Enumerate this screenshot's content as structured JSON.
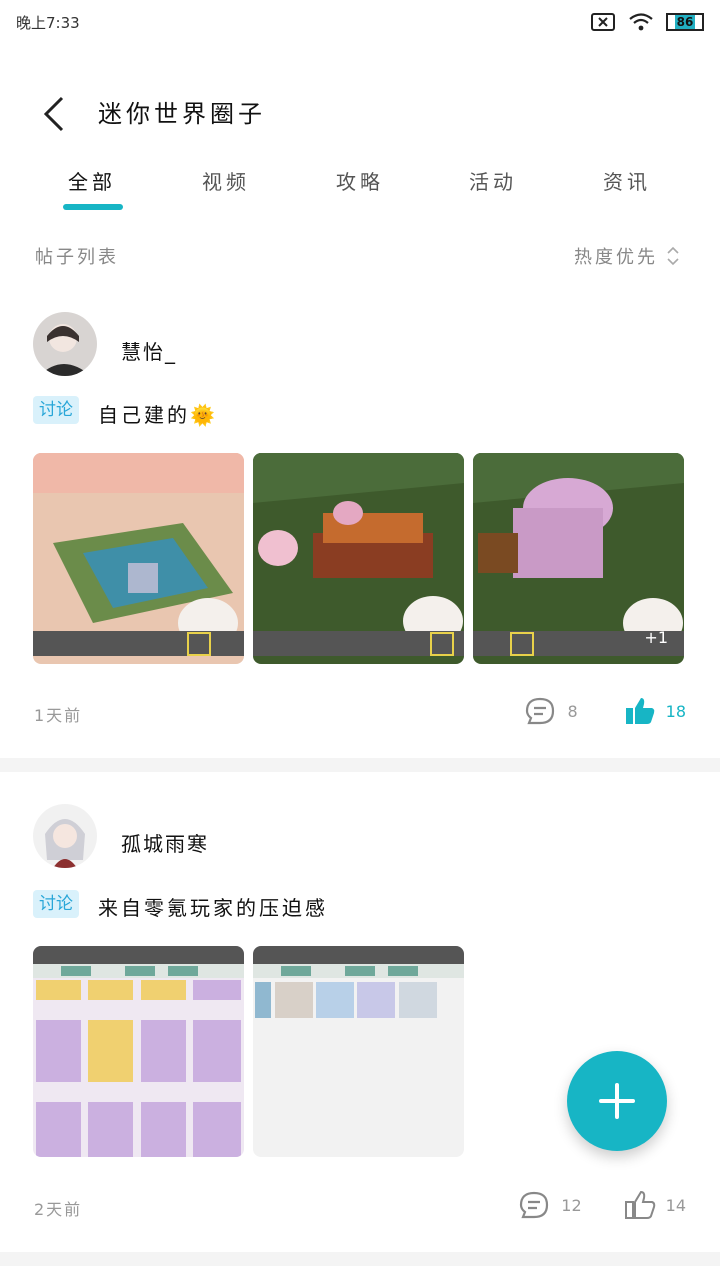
{
  "status_bar": {
    "time": "晚上7:33",
    "battery": "86"
  },
  "header": {
    "title": "迷你世界圈子"
  },
  "tabs": [
    {
      "label": "全部"
    },
    {
      "label": "视频"
    },
    {
      "label": "攻略"
    },
    {
      "label": "活动"
    },
    {
      "label": "资讯"
    }
  ],
  "list_header": {
    "title": "帖子列表",
    "sort_label": "热度优先"
  },
  "posts": [
    {
      "username": "慧怡_",
      "tag": "讨论",
      "text": "自己建的",
      "emoji": "🌞",
      "image_badge": "+1",
      "time": "1天前",
      "comments": "8",
      "likes": "18"
    },
    {
      "username": "孤城雨寒",
      "tag": "讨论",
      "text": "来自零氪玩家的压迫感",
      "time": "2天前",
      "comments": "12",
      "likes": "14"
    }
  ],
  "colors": {
    "accent": "#17b5c5",
    "tag_bg": "#d9f1fb",
    "tag_text": "#28a6d8"
  }
}
